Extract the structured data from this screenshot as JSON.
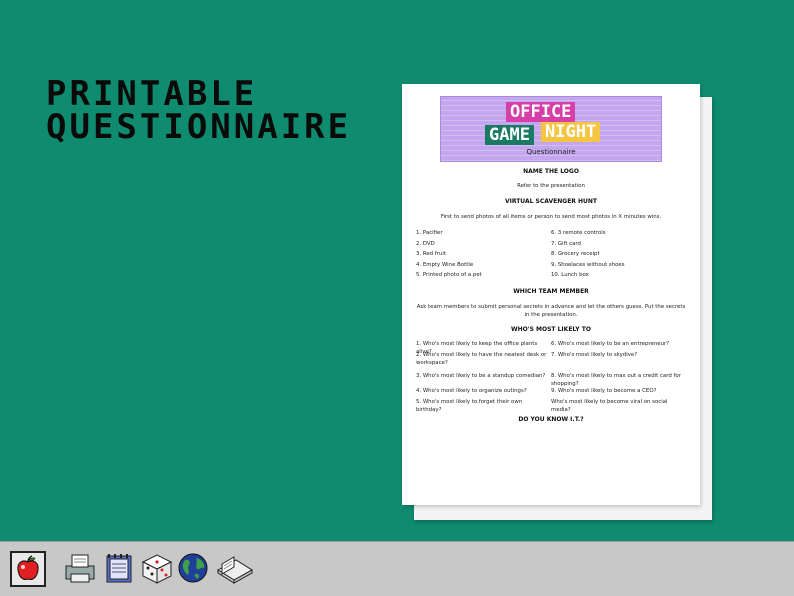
{
  "headline": {
    "line1": "PRINTABLE",
    "line2": "QUESTIONNAIRE"
  },
  "banner": {
    "office": "OFFICE",
    "game": "GAME",
    "night": "NIGHT",
    "subtitle": "Questionnaire"
  },
  "sections": {
    "logo": {
      "title": "NAME THE LOGO",
      "text": "Refer to the presentation"
    },
    "hunt": {
      "title": "VIRTUAL SCAVENGER HUNT",
      "text": "First to send photos of all items or person to send most photos in X minutes wins.",
      "left": [
        "1. Pacifier",
        "2. DVD",
        "3. Red fruit",
        "4. Empty Wine Bottle",
        "5. Printed photo of a pet"
      ],
      "right": [
        "6. 3 remote controls",
        "7. Gift card",
        "8. Grocery receipt",
        "9. Shoelaces without shoes",
        "10. Lunch box"
      ]
    },
    "member": {
      "title": "WHICH TEAM MEMBER",
      "text": "Ask team members to submit personal secrets in advance and let the others guess. Put the secrets in the presentation."
    },
    "likely": {
      "title": "WHO'S MOST LIKELY TO",
      "left": [
        "1. Who's most likely to keep the office plants alive?",
        "2. Who's most likely to have the neatest desk or workspace?",
        "3. Who's most likely to be a standup comedian?",
        "4. Who's most likely to organize outings?",
        "5. Who's most likely to forget their own birthday?"
      ],
      "right": [
        "6. Who's most likely to be an entrepreneur?",
        "7. Who's most likely to skydive?",
        "8. Who's most likely to max out a credit card for shopping?",
        "9. Who's most likely to become a CEO?",
        "Who's most likely to become viral on social media?"
      ]
    },
    "knowit": {
      "title": "DO YOU KNOW I.T.?"
    }
  },
  "taskbar": {
    "icons": [
      "apple-icon",
      "printer-icon",
      "notepad-icon",
      "dice-icon",
      "globe-icon",
      "scanner-icon"
    ]
  },
  "colors": {
    "background": "#0f8c6f",
    "banner": "#c4a6ee",
    "office": "#d63ea8",
    "game": "#1b7a64",
    "night": "#f5c542"
  }
}
